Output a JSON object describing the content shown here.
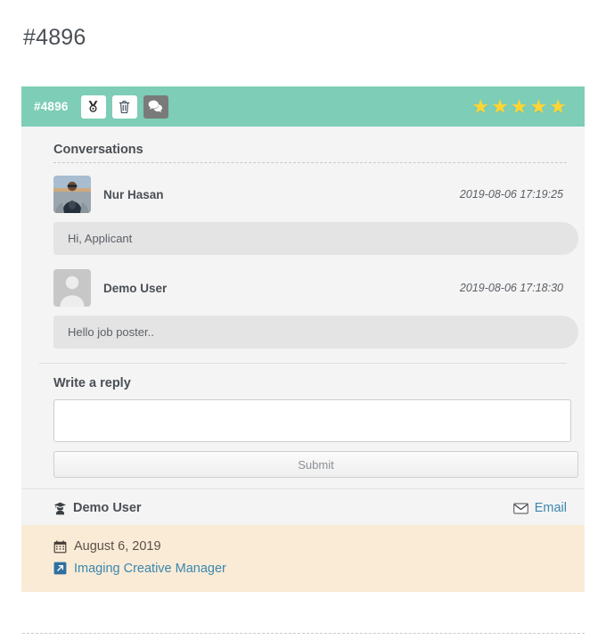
{
  "page": {
    "title": "#4896"
  },
  "card": {
    "header": {
      "ref_id": "#4896",
      "teal_color": "#7ecdb6",
      "buttons": [
        {
          "name": "award-icon",
          "label": "Award",
          "style": "light"
        },
        {
          "name": "trash-icon",
          "label": "Delete",
          "style": "light"
        },
        {
          "name": "comments-icon",
          "label": "Conversations",
          "style": "dark"
        }
      ],
      "rating": {
        "value": 5,
        "max": 5,
        "star_color": "#ffd633",
        "glyph": "★"
      }
    },
    "conversations": {
      "title": "Conversations",
      "messages": [
        {
          "author": "Nur Hasan",
          "timestamp": "2019-08-06 17:19:25",
          "text": "Hi, Applicant",
          "avatar_type": "photo"
        },
        {
          "author": "Demo User",
          "timestamp": "2019-08-06 17:18:30",
          "text": "Hello job poster..",
          "avatar_type": "placeholder"
        }
      ]
    },
    "reply": {
      "title": "Write a reply",
      "textarea_value": "",
      "textarea_placeholder": "",
      "submit_label": "Submit"
    },
    "meta": {
      "user_name": "Demo User",
      "user_icon": "user-graduate-icon",
      "email_label": "Email",
      "email_icon": "envelope-icon",
      "link_color": "#3a87ad"
    },
    "details": {
      "background_color": "#faebd7",
      "date": "August 6, 2019",
      "date_icon": "calendar-icon",
      "job_title": "Imaging Creative Manager",
      "job_icon": "external-link-icon"
    }
  }
}
